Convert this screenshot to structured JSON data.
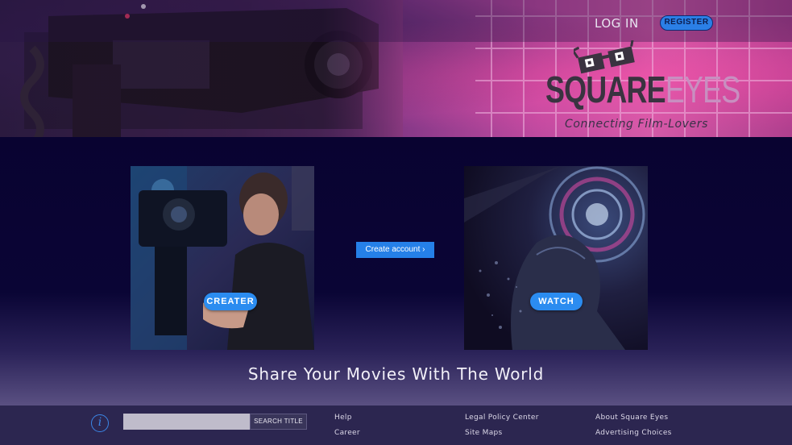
{
  "header": {
    "login_label": "LOG IN",
    "register_label": "REGISTER",
    "logo": {
      "name_primary": "SQUARE",
      "name_secondary": "EYES",
      "tagline": "Connecting Film-Lovers"
    }
  },
  "main": {
    "creator_button": "CREATER",
    "watch_button": "WATCH",
    "create_account_label": "Create account ›",
    "tagline": "Share Your Movies With The World"
  },
  "footer": {
    "info_icon_glyph": "i",
    "search_placeholder": "",
    "search_button": "SEARCH TITLE",
    "links": {
      "help": "Help",
      "career": "Career",
      "legal": "Legal Policy Center",
      "sitemaps": "Site Maps",
      "about": "About Square Eyes",
      "advertising": "Advertising Choices"
    }
  },
  "colors": {
    "accent_blue": "#2b8cf0",
    "page_bg": "#0a0533",
    "footer_bg": "#2c2650"
  },
  "icons": [
    "info-icon",
    "glasses-logo-icon"
  ]
}
